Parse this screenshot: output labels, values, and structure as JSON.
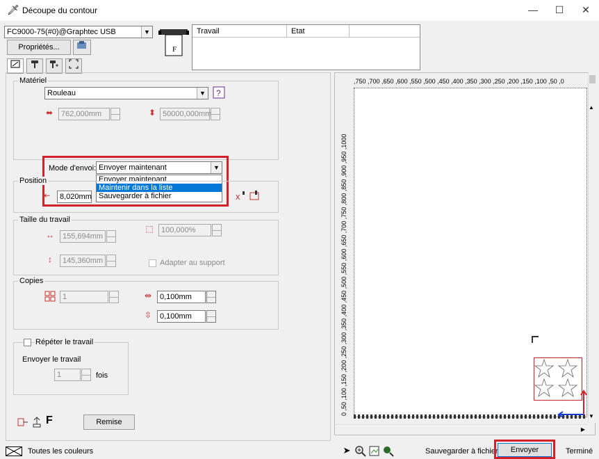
{
  "window": {
    "title": "Découpe du contour",
    "minimize": "—",
    "maximize": "☐",
    "close": "✕"
  },
  "device": {
    "name": "FC9000-75(#0)@Graphtec USB",
    "properties_label": "Propriétés..."
  },
  "jobs_table": {
    "col_job": "Travail",
    "col_state": "Etat"
  },
  "material": {
    "group_label": "Matériel",
    "type_value": "Rouleau",
    "width_value": "762,000mm",
    "length_value": "50000,000mm"
  },
  "send_mode": {
    "label": "Mode d'envoi:",
    "selected": "Envoyer maintenant",
    "options": [
      "Envoyer maintenant",
      "Maintenir dans la liste",
      "Sauvegarder à fichier"
    ]
  },
  "position": {
    "group_label": "Position",
    "offset_value": "8,020mm"
  },
  "job_size": {
    "group_label": "Taille du travail",
    "width_value": "155,694mm",
    "height_value": "145,360mm",
    "scale_value": "100,000%",
    "fit_label": "Adapter au support"
  },
  "copies": {
    "group_label": "Copies",
    "count_value": "1",
    "spacing_x_value": "0,100mm",
    "spacing_y_value": "0,100mm"
  },
  "repeat": {
    "checkbox_label": "Répéter le travail",
    "send_label": "Envoyer le travail",
    "count_value": "1",
    "unit_label": "fois"
  },
  "bottom_left": {
    "f_label": "F",
    "reset_label": "Remise"
  },
  "ruler": {
    "top": ",750 ,700 ,650 ,600 ,550 ,500 ,450 ,400 ,350 ,300 ,250 ,200 ,150 ,100 ,50  ,0",
    "left": "0 ,50 ,100 ,150 ,200 ,250 ,300 ,350 ,400 ,450 ,500 ,550 ,600 ,650 ,700 ,750 ,800 ,850 ,900 ,950 ,1000"
  },
  "status_bar": {
    "all_colors_label": "Toutes les couleurs",
    "save_file_label": "Sauvegarder à fichier",
    "send_label": "Envoyer",
    "done_label": "Terminé"
  },
  "colors": {
    "highlight_red": "#d4202a",
    "selection_blue": "#0078d7",
    "design_red": "#c8202a"
  }
}
